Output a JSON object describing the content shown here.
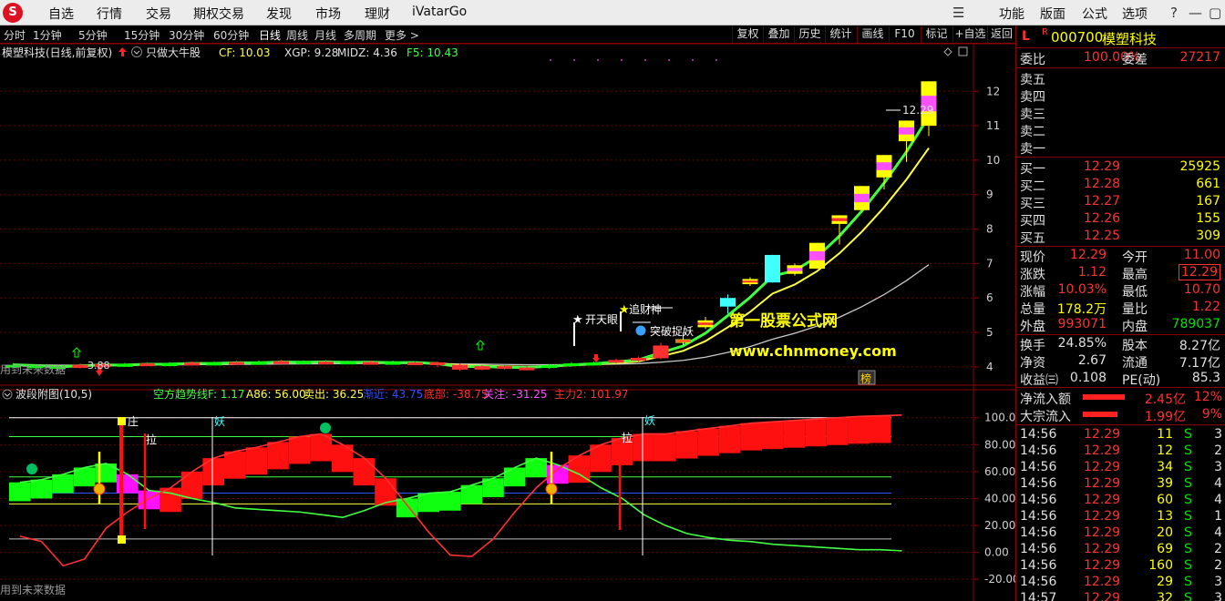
{
  "menu": {
    "logo": "S",
    "items": [
      "自选",
      "行情",
      "交易",
      "期权交易",
      "发现",
      "市场",
      "理财",
      "iVatarGo"
    ],
    "right": [
      "功能",
      "版面",
      "公式",
      "选项"
    ]
  },
  "periods": [
    "分时",
    "1分钟",
    "5分钟",
    "15分钟",
    "30分钟",
    "60分钟",
    "日线",
    "周线",
    "月线",
    "多周期",
    "更多 >"
  ],
  "active_period": "日线",
  "tools": [
    "复权",
    "叠加",
    "历史",
    "统计",
    "画线",
    "F10",
    "标记",
    "+自选",
    "返回"
  ],
  "main_chart": {
    "title": "模塑科技(日线,前复权)",
    "formula": "只做大牛股",
    "indicators": [
      {
        "label": "CF: 10.03",
        "color": "#ffff40"
      },
      {
        "label": "XGP: 9.28",
        "color": "#e0e0e0"
      },
      {
        "label": "MIDZ: 4.36",
        "color": "#e0e0e0"
      },
      {
        "label": "F5: 10.43",
        "color": "#40ff40"
      }
    ],
    "yticks": [
      4,
      5,
      6,
      7,
      8,
      9,
      10,
      11,
      12
    ],
    "last_label": "12.29",
    "low_label": "3.88",
    "signals": {
      "kty": "开天眼",
      "zcs": "追财神",
      "tpzy": "突破捉妖"
    },
    "footer": "用到未来数据",
    "watermark1": "第一股票公式网",
    "watermark2": "www.chnmoney.com",
    "badge": "榜"
  },
  "sub_chart": {
    "title": "波段附图(10,5)",
    "indicators": [
      {
        "label": "空方趋势线F: 1.17",
        "color": "#40ff40"
      },
      {
        "label": "A86: 56.00",
        "color": "#ffff40"
      },
      {
        "label": "卖出: 36.25",
        "color": "#ffff40"
      },
      {
        "label": "渐近: 43.75",
        "color": "#3050ff"
      },
      {
        "label": "底部: -38.75",
        "color": "#ff3030"
      },
      {
        "label": "关注: -31.25",
        "color": "#ff50ff"
      },
      {
        "label": "主力2: 101.97",
        "color": "#ff3030"
      }
    ],
    "yticks": [
      "100.0",
      "80.00",
      "60.00",
      "40.00",
      "20.00",
      "0.00",
      "-20.00"
    ],
    "markers": {
      "zhuang": "庄",
      "la1": "拉",
      "yao1": "妖",
      "la2": "拉",
      "yao2": "妖"
    },
    "footer": "用到未来数据"
  },
  "quote": {
    "mark": "L",
    "r": "R",
    "code": "000700",
    "name": "模塑科技",
    "wb_label": "委比",
    "wb_value": "100.00%",
    "wc_label": "委差",
    "wc_value": "27217",
    "asks": [
      {
        "label": "卖五",
        "price": "",
        "vol": ""
      },
      {
        "label": "卖四",
        "price": "",
        "vol": ""
      },
      {
        "label": "卖三",
        "price": "",
        "vol": ""
      },
      {
        "label": "卖二",
        "price": "",
        "vol": ""
      },
      {
        "label": "卖一",
        "price": "",
        "vol": ""
      }
    ],
    "bids": [
      {
        "label": "买一",
        "price": "12.29",
        "vol": "25925"
      },
      {
        "label": "买二",
        "price": "12.28",
        "vol": "661"
      },
      {
        "label": "买三",
        "price": "12.27",
        "vol": "167"
      },
      {
        "label": "买四",
        "price": "12.26",
        "vol": "155"
      },
      {
        "label": "买五",
        "price": "12.25",
        "vol": "309"
      }
    ],
    "stats": [
      {
        "l1": "现价",
        "v1": "12.29",
        "c1": "r",
        "l2": "今开",
        "v2": "11.00",
        "c2": "r"
      },
      {
        "l1": "涨跌",
        "v1": "1.12",
        "c1": "r",
        "l2": "最高",
        "v2": "12.29",
        "c2": "r",
        "box": true
      },
      {
        "l1": "涨幅",
        "v1": "10.03%",
        "c1": "r",
        "l2": "最低",
        "v2": "10.70",
        "c2": "r"
      },
      {
        "l1": "总量",
        "v1": "178.2万",
        "c1": "y",
        "l2": "量比",
        "v2": "1.22",
        "c2": "r"
      },
      {
        "l1": "外盘",
        "v1": "993071",
        "c1": "r",
        "l2": "内盘",
        "v2": "789037",
        "c2": "g"
      }
    ],
    "stats2": [
      {
        "l1": "换手",
        "v1": "24.85%",
        "l2": "股本",
        "v2": "8.27亿"
      },
      {
        "l1": "净资",
        "v1": "2.67",
        "l2": "流通",
        "v2": "7.17亿"
      },
      {
        "l1": "收益㈢",
        "v1": "0.108",
        "l2": "PE(动)",
        "v2": "85.3"
      }
    ],
    "flows": [
      {
        "label": "净流入额",
        "value": "2.45亿",
        "pct": "12%",
        "bar": 68
      },
      {
        "label": "大宗流入",
        "value": "1.99亿",
        "pct": "9%",
        "bar": 56
      }
    ],
    "ticks": [
      {
        "t": "14:56",
        "p": "12.29",
        "v": "11",
        "s": "S",
        "n": "3"
      },
      {
        "t": "14:56",
        "p": "12.29",
        "v": "12",
        "s": "S",
        "n": "2"
      },
      {
        "t": "14:56",
        "p": "12.29",
        "v": "34",
        "s": "S",
        "n": "3"
      },
      {
        "t": "14:56",
        "p": "12.29",
        "v": "39",
        "s": "S",
        "n": "4"
      },
      {
        "t": "14:56",
        "p": "12.29",
        "v": "60",
        "s": "S",
        "n": "4"
      },
      {
        "t": "14:56",
        "p": "12.29",
        "v": "13",
        "s": "S",
        "n": "1"
      },
      {
        "t": "14:56",
        "p": "12.29",
        "v": "20",
        "s": "S",
        "n": "4"
      },
      {
        "t": "14:56",
        "p": "12.29",
        "v": "69",
        "s": "S",
        "n": "2"
      },
      {
        "t": "14:56",
        "p": "12.29",
        "v": "160",
        "s": "S",
        "n": "2"
      },
      {
        "t": "14:56",
        "p": "12.29",
        "v": "29",
        "s": "S",
        "n": "3"
      },
      {
        "t": "14:57",
        "p": "12.29",
        "v": "32",
        "s": "S",
        "n": "3"
      }
    ]
  },
  "chart_data": [
    {
      "type": "candlestick",
      "title": "模塑科技(日线,前复权)",
      "ylim": [
        3.6,
        12.8
      ],
      "candles": [
        {
          "o": 4.0,
          "c": 4.06,
          "h": 4.1,
          "l": 3.97,
          "col": "#00ff00"
        },
        {
          "o": 4.04,
          "c": 4.02,
          "h": 4.08,
          "l": 3.99,
          "col": "#00ff00"
        },
        {
          "o": 4.02,
          "c": 3.96,
          "h": 4.06,
          "l": 3.88,
          "col": "#00ff00"
        },
        {
          "o": 3.97,
          "c": 4.06,
          "h": 4.1,
          "l": 3.95,
          "col": "#ff3030"
        },
        {
          "o": 4.06,
          "c": 4.08,
          "h": 4.12,
          "l": 4.02,
          "col": "#ff3030"
        },
        {
          "o": 4.08,
          "c": 4.05,
          "h": 4.12,
          "l": 4.02,
          "col": "#00ff00"
        },
        {
          "o": 4.05,
          "c": 4.1,
          "h": 4.14,
          "l": 4.03,
          "col": "#ff3030"
        },
        {
          "o": 4.1,
          "c": 4.08,
          "h": 4.14,
          "l": 4.05,
          "col": "#00ff00"
        },
        {
          "o": 4.08,
          "c": 4.12,
          "h": 4.16,
          "l": 4.06,
          "col": "#ff3030"
        },
        {
          "o": 4.12,
          "c": 4.1,
          "h": 4.16,
          "l": 4.07,
          "col": "#00ff00"
        },
        {
          "o": 4.1,
          "c": 4.14,
          "h": 4.18,
          "l": 4.08,
          "col": "#ff3030"
        },
        {
          "o": 4.14,
          "c": 4.12,
          "h": 4.18,
          "l": 4.09,
          "col": "#00ff00"
        },
        {
          "o": 4.12,
          "c": 4.16,
          "h": 4.2,
          "l": 4.1,
          "col": "#ff3030"
        },
        {
          "o": 4.16,
          "c": 4.13,
          "h": 4.19,
          "l": 4.1,
          "col": "#00ff00"
        },
        {
          "o": 4.13,
          "c": 4.15,
          "h": 4.2,
          "l": 4.1,
          "col": "#ff3030"
        },
        {
          "o": 4.15,
          "c": 4.12,
          "h": 4.18,
          "l": 4.08,
          "col": "#00ff00"
        },
        {
          "o": 4.12,
          "c": 4.14,
          "h": 4.18,
          "l": 4.09,
          "col": "#ff3030"
        },
        {
          "o": 4.14,
          "c": 4.11,
          "h": 4.18,
          "l": 4.08,
          "col": "#00ff00"
        },
        {
          "o": 4.11,
          "c": 4.13,
          "h": 4.17,
          "l": 4.08,
          "col": "#ff3030"
        },
        {
          "o": 4.13,
          "c": 4.06,
          "h": 4.16,
          "l": 4.0,
          "col": "#ff3030"
        },
        {
          "o": 4.06,
          "c": 3.92,
          "h": 4.1,
          "l": 3.88,
          "col": "#ff3030"
        },
        {
          "o": 3.92,
          "c": 4.02,
          "h": 4.06,
          "l": 3.9,
          "col": "#ff3030"
        },
        {
          "o": 4.02,
          "c": 3.96,
          "h": 4.06,
          "l": 3.92,
          "col": "#ff3030"
        },
        {
          "o": 3.96,
          "c": 3.98,
          "h": 4.02,
          "l": 3.93,
          "col": "#ff3030"
        },
        {
          "o": 3.98,
          "c": 4.05,
          "h": 4.08,
          "l": 3.95,
          "col": "#00ff00"
        },
        {
          "o": 4.05,
          "c": 4.1,
          "h": 4.14,
          "l": 4.02,
          "col": "#00ff00"
        },
        {
          "o": 4.1,
          "c": 4.12,
          "h": 4.16,
          "l": 4.07,
          "col": "#00ff00"
        },
        {
          "o": 4.12,
          "c": 4.2,
          "h": 4.24,
          "l": 4.1,
          "col": "#ff3030"
        },
        {
          "o": 4.2,
          "c": 4.26,
          "h": 4.3,
          "l": 4.15,
          "col": "#ff3030"
        },
        {
          "o": 4.25,
          "c": 4.62,
          "h": 4.7,
          "l": 4.22,
          "col": "#ff3030"
        },
        {
          "o": 4.7,
          "c": 4.8,
          "h": 5.0,
          "l": 4.6,
          "col": "#ffff00",
          "inner": "#ff3030"
        },
        {
          "o": 5.15,
          "c": 5.35,
          "h": 5.45,
          "l": 5.1,
          "col": "#ffff00",
          "inner": "#ff3030"
        },
        {
          "o": 5.75,
          "c": 6.0,
          "h": 6.1,
          "l": 5.55,
          "col": "#40ffff"
        },
        {
          "o": 6.4,
          "c": 6.55,
          "h": 6.6,
          "l": 6.35,
          "col": "#ffff00",
          "inner": "#ff3030"
        },
        {
          "o": 6.45,
          "c": 7.25,
          "h": 7.25,
          "l": 6.45,
          "col": "#40ffff"
        },
        {
          "o": 6.7,
          "c": 6.95,
          "h": 7.0,
          "l": 6.65,
          "col": "#ffff00",
          "inner": "#ff50ff"
        },
        {
          "o": 6.85,
          "c": 7.6,
          "h": 7.6,
          "l": 6.85,
          "col": "#ffff00",
          "inner": "#ff50ff"
        },
        {
          "o": 8.15,
          "c": 8.4,
          "h": 8.4,
          "l": 7.55,
          "col": "#ffff00",
          "inner": "#ff3030"
        },
        {
          "o": 8.55,
          "c": 9.25,
          "h": 9.25,
          "l": 8.55,
          "col": "#ffff00",
          "inner": "#ff50ff"
        },
        {
          "o": 9.5,
          "c": 10.15,
          "h": 10.15,
          "l": 9.15,
          "col": "#ffff00",
          "inner": "#ff50ff"
        },
        {
          "o": 10.55,
          "c": 11.15,
          "h": 11.15,
          "l": 9.95,
          "col": "#ffff00",
          "inner": "#ff50ff"
        },
        {
          "o": 11.0,
          "c": 12.29,
          "h": 12.29,
          "l": 10.7,
          "col": "#ffff00",
          "inner": "#ff50ff"
        }
      ]
    },
    {
      "type": "line",
      "title": "波段附图(10,5)",
      "ylim": [
        -28,
        112
      ],
      "series": [
        {
          "name": "空方趋势线F",
          "color": "#40ff40",
          "values": [
            52,
            54,
            58,
            63,
            66,
            58,
            46,
            44,
            40,
            37,
            33,
            32,
            31,
            30,
            28,
            26,
            31,
            37,
            40,
            44,
            45,
            50,
            55,
            63,
            70,
            65,
            58,
            48,
            40,
            28,
            20,
            14,
            11,
            9,
            8,
            6,
            5,
            4,
            3,
            2,
            2,
            1.17
          ]
        },
        {
          "name": "主力2",
          "color": "#ff3030",
          "values": [
            12,
            8,
            -10,
            -5,
            18,
            30,
            40,
            48,
            60,
            70,
            75,
            78,
            82,
            86,
            88,
            80,
            70,
            55,
            35,
            15,
            -2,
            -3,
            10,
            30,
            48,
            62,
            72,
            80,
            85,
            88,
            88,
            90,
            92,
            94,
            96,
            97,
            98,
            99,
            100,
            101,
            101.5,
            101.97
          ]
        }
      ]
    }
  ]
}
